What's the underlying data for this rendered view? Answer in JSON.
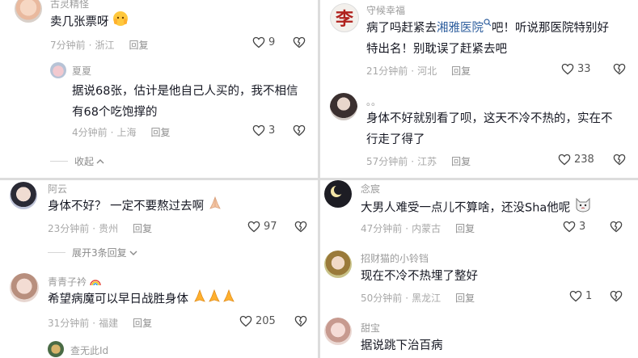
{
  "p1": {
    "c1": {
      "name": "古灵精怪",
      "text": "卖几张票呀",
      "time": "7分钟前",
      "loc": "浙江",
      "reply": "回复",
      "likes": "9"
    },
    "c2": {
      "name": "夏夏",
      "line1": "据说68张，估计是他自己人买的，我不相信",
      "line2": "有68个吃饱撑的",
      "time": "4分钟前",
      "loc": "上海",
      "reply": "回复",
      "likes": "3"
    },
    "collapse": "收起"
  },
  "p2": {
    "c1": {
      "name": "守候幸福",
      "line1_a": "病了吗赶紧去",
      "line1_link": "湘雅医院",
      "line1_b": "吧！听说那医院特别好",
      "line2": "特出名！别耽误了赶紧去吧",
      "time": "21分钟前",
      "loc": "河北",
      "reply": "回复",
      "likes": "33",
      "avatar_char": "李"
    },
    "c2": {
      "name": "。。",
      "line1": "身体不好就别看了呗，这天不冷不热的，实在不",
      "line2": "行走了得了",
      "time": "57分钟前",
      "loc": "江苏",
      "reply": "回复",
      "likes": "238"
    }
  },
  "p3": {
    "c1": {
      "name": "阿云",
      "text": "身体不好？ 一定不要熬过去啊",
      "time": "23分钟前",
      "loc": "贵州",
      "reply": "回复",
      "likes": "97"
    },
    "expand": "展开3条回复",
    "c2": {
      "name": "青青子衿",
      "text": "希望病魔可以早日战胜身体",
      "time": "31分钟前",
      "loc": "福建",
      "reply": "回复",
      "likes": "205"
    },
    "c3": {
      "name": "查无此Id"
    }
  },
  "p4": {
    "c1": {
      "name": "念宸",
      "text": "大男人难受一点儿不算啥，还没Sha他呢",
      "time": "47分钟前",
      "loc": "内蒙古",
      "reply": "回复",
      "likes": "3"
    },
    "c2": {
      "name": "招财猫的小铃铛",
      "text": "现在不冷不热埋了整好",
      "time": "50分钟前",
      "loc": "黑龙江",
      "reply": "回复",
      "likes": "1"
    },
    "c3": {
      "name": "甜宝",
      "text": "据说跳下治百病"
    }
  },
  "colors": {
    "text": "#161823",
    "meta": "#a8a8a8",
    "link": "#2f5f9e",
    "divider": "#dcdcdc"
  }
}
